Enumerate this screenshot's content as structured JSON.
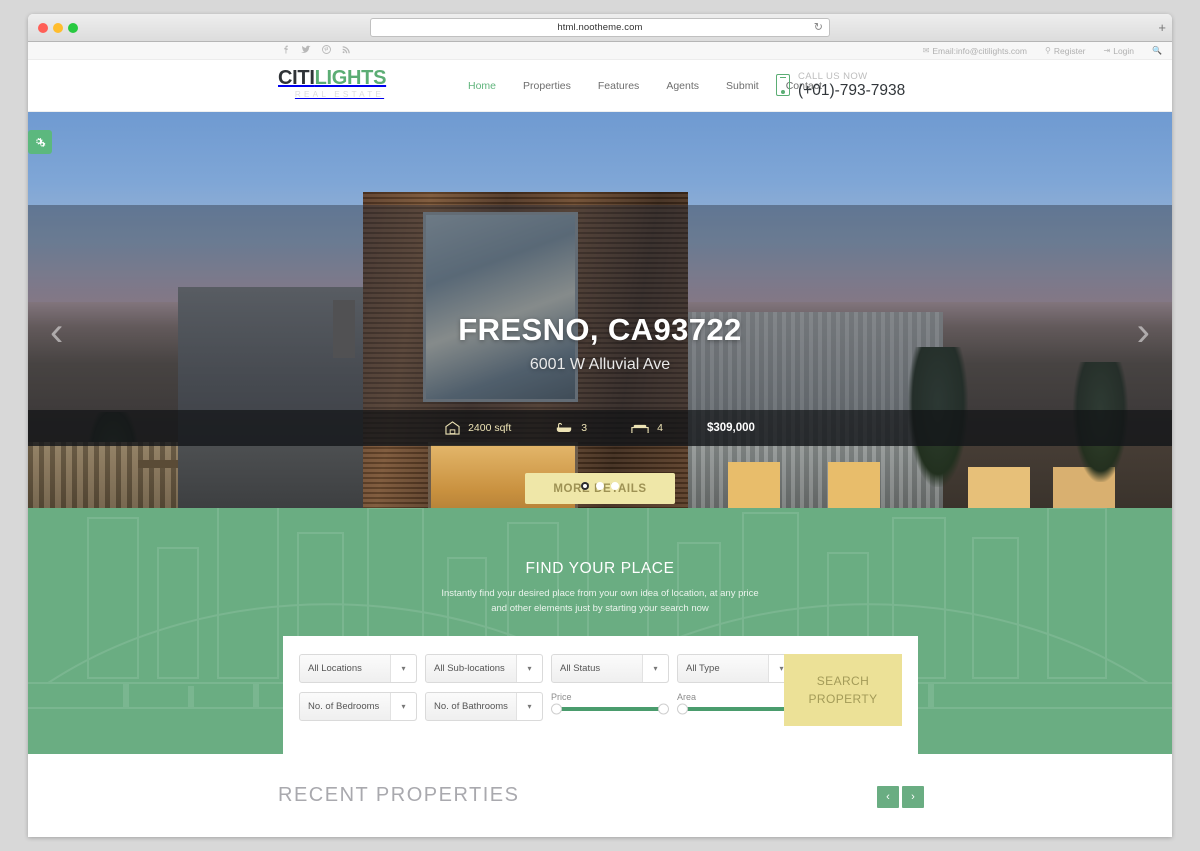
{
  "browser": {
    "url": "html.nootheme.com",
    "reload_icon": "reload-icon",
    "new_tab_icon": "plus-icon"
  },
  "topbar": {
    "social": [
      {
        "name": "facebook-icon",
        "glyph": "f"
      },
      {
        "name": "twitter-icon",
        "glyph": "🐦"
      },
      {
        "name": "pinterest-icon",
        "glyph": "ⓟ"
      },
      {
        "name": "rss-icon",
        "glyph": "◔"
      }
    ],
    "email_label": "Email:info@citilights.com",
    "register_label": "Register",
    "login_label": "Login",
    "search_icon": "search-icon"
  },
  "header": {
    "logo": {
      "part1": "CITI",
      "part2": "LIGHTS",
      "tagline": "REAL ESTATE"
    },
    "nav": [
      {
        "label": "Home",
        "active": true
      },
      {
        "label": "Properties",
        "active": false
      },
      {
        "label": "Features",
        "active": false
      },
      {
        "label": "Agents",
        "active": false
      },
      {
        "label": "Submit",
        "active": false
      },
      {
        "label": "Contact",
        "active": false
      }
    ],
    "phone": {
      "label": "CALL US NOW",
      "number": "(+01)-793-7938"
    }
  },
  "hero": {
    "title": "FRESNO, CA93722",
    "subtitle": "6001 W Alluvial Ave",
    "stats": [
      {
        "icon": "area-home-icon",
        "value": "2400 sqft"
      },
      {
        "icon": "bathtub-icon",
        "value": "3"
      },
      {
        "icon": "bed-icon",
        "value": "4"
      }
    ],
    "price": "$309,000",
    "cta_label": "MORE DETAILS",
    "prev_arrow": "‹",
    "next_arrow": "›",
    "dots": [
      true,
      false,
      false
    ],
    "theme_toggle_icon": "gears-icon"
  },
  "search": {
    "heading": "FIND YOUR PLACE",
    "subtext_line1": "Instantly find your desired place from your own idea of location, at any price",
    "subtext_line2": "and other elements just by starting your search now",
    "selects_row1": [
      "All Locations",
      "All Sub-locations",
      "All Status",
      "All Type"
    ],
    "selects_row2": [
      "No. of Bedrooms",
      "No. of Bathrooms"
    ],
    "sliders": [
      {
        "label": "Price"
      },
      {
        "label": "Area"
      }
    ],
    "button_line1": "SEARCH",
    "button_line2": "PROPERTY",
    "caret_icon": "chevron-down-icon"
  },
  "recent": {
    "title": "RECENT PROPERTIES",
    "prev_label": "‹",
    "next_label": "›"
  },
  "colors": {
    "green": "#6aad82",
    "brand_green": "#5bad74",
    "yellow": "#ece197",
    "cta_yellow": "#efe7a8"
  }
}
